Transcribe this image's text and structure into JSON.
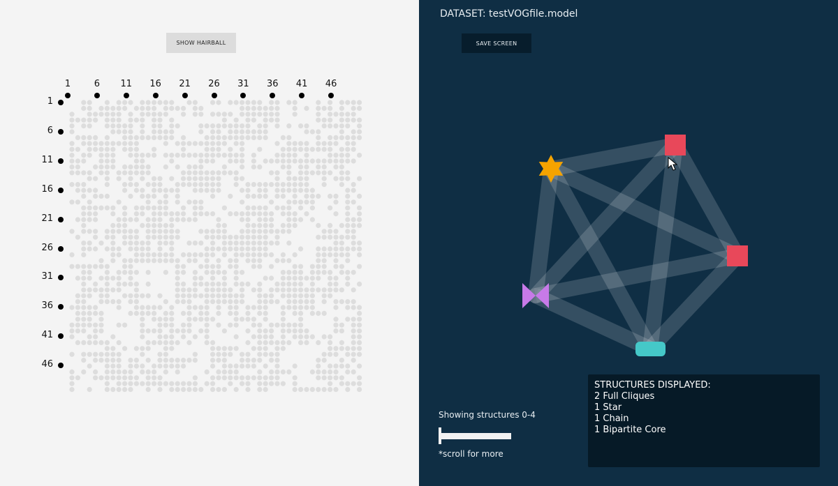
{
  "left": {
    "hairball_button": "SHOW HAIRBALL",
    "column_labels": [
      "1",
      "6",
      "11",
      "16",
      "21",
      "26",
      "31",
      "36",
      "41",
      "46"
    ],
    "row_labels": [
      "1",
      "6",
      "11",
      "16",
      "21",
      "26",
      "31",
      "36",
      "41",
      "46"
    ]
  },
  "right": {
    "dataset_label": "DATASET: testVOGfile.model",
    "save_button": "SAVE SCREEN",
    "showing_text": "Showing structures 0-4",
    "scroll_hint": "*scroll for more",
    "slider_value": 0,
    "panel": {
      "title": "STRUCTURES DISPLAYED:",
      "items": [
        "2 Full Cliques",
        "1 Star",
        "1 Chain",
        "1 Bipartite Core"
      ]
    },
    "colors": {
      "clique": "#e8485a",
      "star": "#f5a300",
      "chain": "#45c8c8",
      "bipartite": "#c77ae8",
      "edge": "#ffffff"
    },
    "nodes": [
      {
        "type": "star",
        "icon": "star-icon"
      },
      {
        "type": "clique",
        "icon": "square-icon"
      },
      {
        "type": "clique",
        "icon": "square-icon"
      },
      {
        "type": "bipartite",
        "icon": "bowtie-icon"
      },
      {
        "type": "chain",
        "icon": "rounded-rect-icon"
      }
    ]
  }
}
